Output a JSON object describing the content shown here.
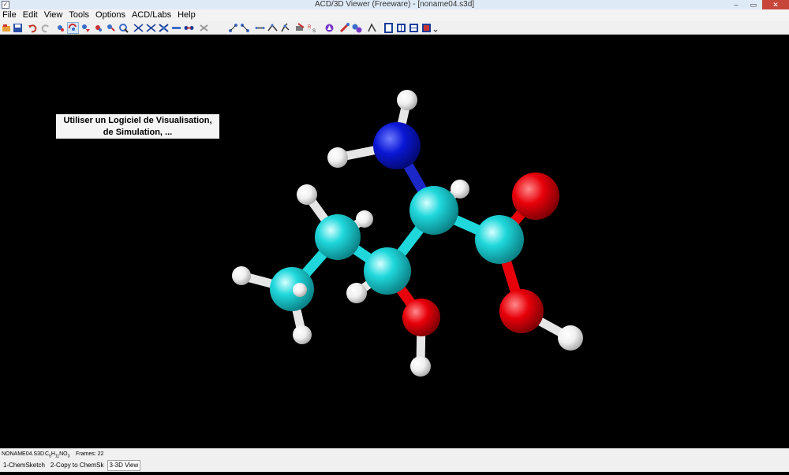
{
  "window": {
    "title": "ACD/3D Viewer (Freeware) - [noname04.s3d]",
    "controls": [
      "–",
      "▭",
      "✕"
    ]
  },
  "menu": [
    "File",
    "Edit",
    "View",
    "Tools",
    "Options",
    "ACD/Labs",
    "Help"
  ],
  "toolbar": {
    "icons": [
      "open-icon",
      "save-icon",
      "undo-icon",
      "redo-icon",
      "select-tool-icon",
      "rotate-tool-icon",
      "move-tool-icon",
      "zoom-tool-icon",
      "magnify-icon",
      "bond-single-icon",
      "bond-double-icon",
      "bond-triple-icon",
      "bond-stick-icon",
      "bond-wire-icon",
      "bond-dots-icon",
      "distance-icon",
      "angle-icon",
      "dihedral-icon",
      "fragment-icon",
      "rotate-bond-icon",
      "measure-icon",
      "color-icon",
      "atom-label-icon",
      "surface-icon",
      "display-sticks-icon",
      "display-balls-icon",
      "display-spacefill-icon",
      "display-cylinder-icon",
      "more-options-icon"
    ],
    "active_icon": "rotate-tool-icon"
  },
  "viewport": {
    "note_lines": [
      "Utiliser un Logiciel de Visualisation,",
      "de Simulation, ..."
    ],
    "molecule": {
      "name": "noname04",
      "formula": "C5H11NO3",
      "atom_colors": {
        "C": "#1fd8dc",
        "H": "#f3f3f3",
        "N": "#0a17d6",
        "O": "#e8000a"
      }
    }
  },
  "status": {
    "file": "NONAME04.S3D",
    "formula_prefix": "C",
    "formula_c_count": "5",
    "formula_h_label": "H",
    "formula_h_count": "11",
    "formula_rest": "NO",
    "formula_o_count": "3",
    "frames": "Frames: 22"
  },
  "taskbar": {
    "tabs": [
      {
        "label": "1-ChemSketch",
        "active": false
      },
      {
        "label": "2-Copy to ChemSk",
        "active": false
      },
      {
        "label": "3-3D View",
        "active": true
      }
    ]
  }
}
